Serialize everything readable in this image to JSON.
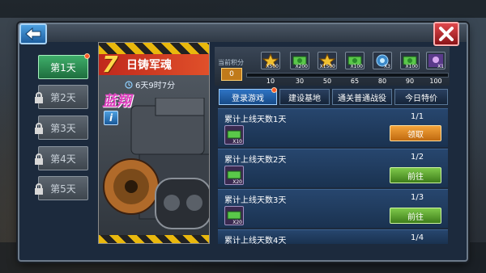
{
  "day_tabs": [
    {
      "label": "第1天",
      "locked": false,
      "active": true
    },
    {
      "label": "第2天",
      "locked": true,
      "active": false
    },
    {
      "label": "第3天",
      "locked": true,
      "active": false
    },
    {
      "label": "第4天",
      "locked": true,
      "active": false
    },
    {
      "label": "第5天",
      "locked": true,
      "active": false
    }
  ],
  "hero": {
    "day_number": "7",
    "title": "日铸军魂",
    "timer": "6天9时7分",
    "name": "蓝翔",
    "info_label": "i"
  },
  "progress": {
    "label": "当前积分",
    "score": "0",
    "milestones": [
      {
        "value": "10",
        "qty": "X500"
      },
      {
        "value": "30",
        "qty": "X200"
      },
      {
        "value": "50",
        "qty": "X1500"
      },
      {
        "value": "65",
        "qty": "X100"
      },
      {
        "value": "80",
        "qty": "X3"
      },
      {
        "value": "90",
        "qty": "X100"
      },
      {
        "value": "100",
        "qty": "X1"
      }
    ]
  },
  "task_tabs": [
    {
      "label": "登录游戏",
      "active": true
    },
    {
      "label": "建设基地",
      "active": false
    },
    {
      "label": "通关普通战役",
      "active": false
    },
    {
      "label": "今日特价",
      "active": false
    }
  ],
  "tasks": [
    {
      "title": "累计上线天数1天",
      "progress": "1/1",
      "reward_qty": "X10",
      "button": "领取",
      "button_type": "claim"
    },
    {
      "title": "累计上线天数2天",
      "progress": "1/2",
      "reward_qty": "X20",
      "button": "前往",
      "button_type": "go"
    },
    {
      "title": "累计上线天数3天",
      "progress": "1/3",
      "reward_qty": "X20",
      "button": "前往",
      "button_type": "go"
    },
    {
      "title": "累计上线天数4天",
      "progress": "1/4",
      "reward_qty": "",
      "button": "",
      "button_type": ""
    }
  ],
  "colors": {
    "accent_green": "#1e6e3e",
    "claim_orange": "#c06a10",
    "go_green": "#3e7e1a",
    "hero_name_pink": "#e040c0"
  }
}
